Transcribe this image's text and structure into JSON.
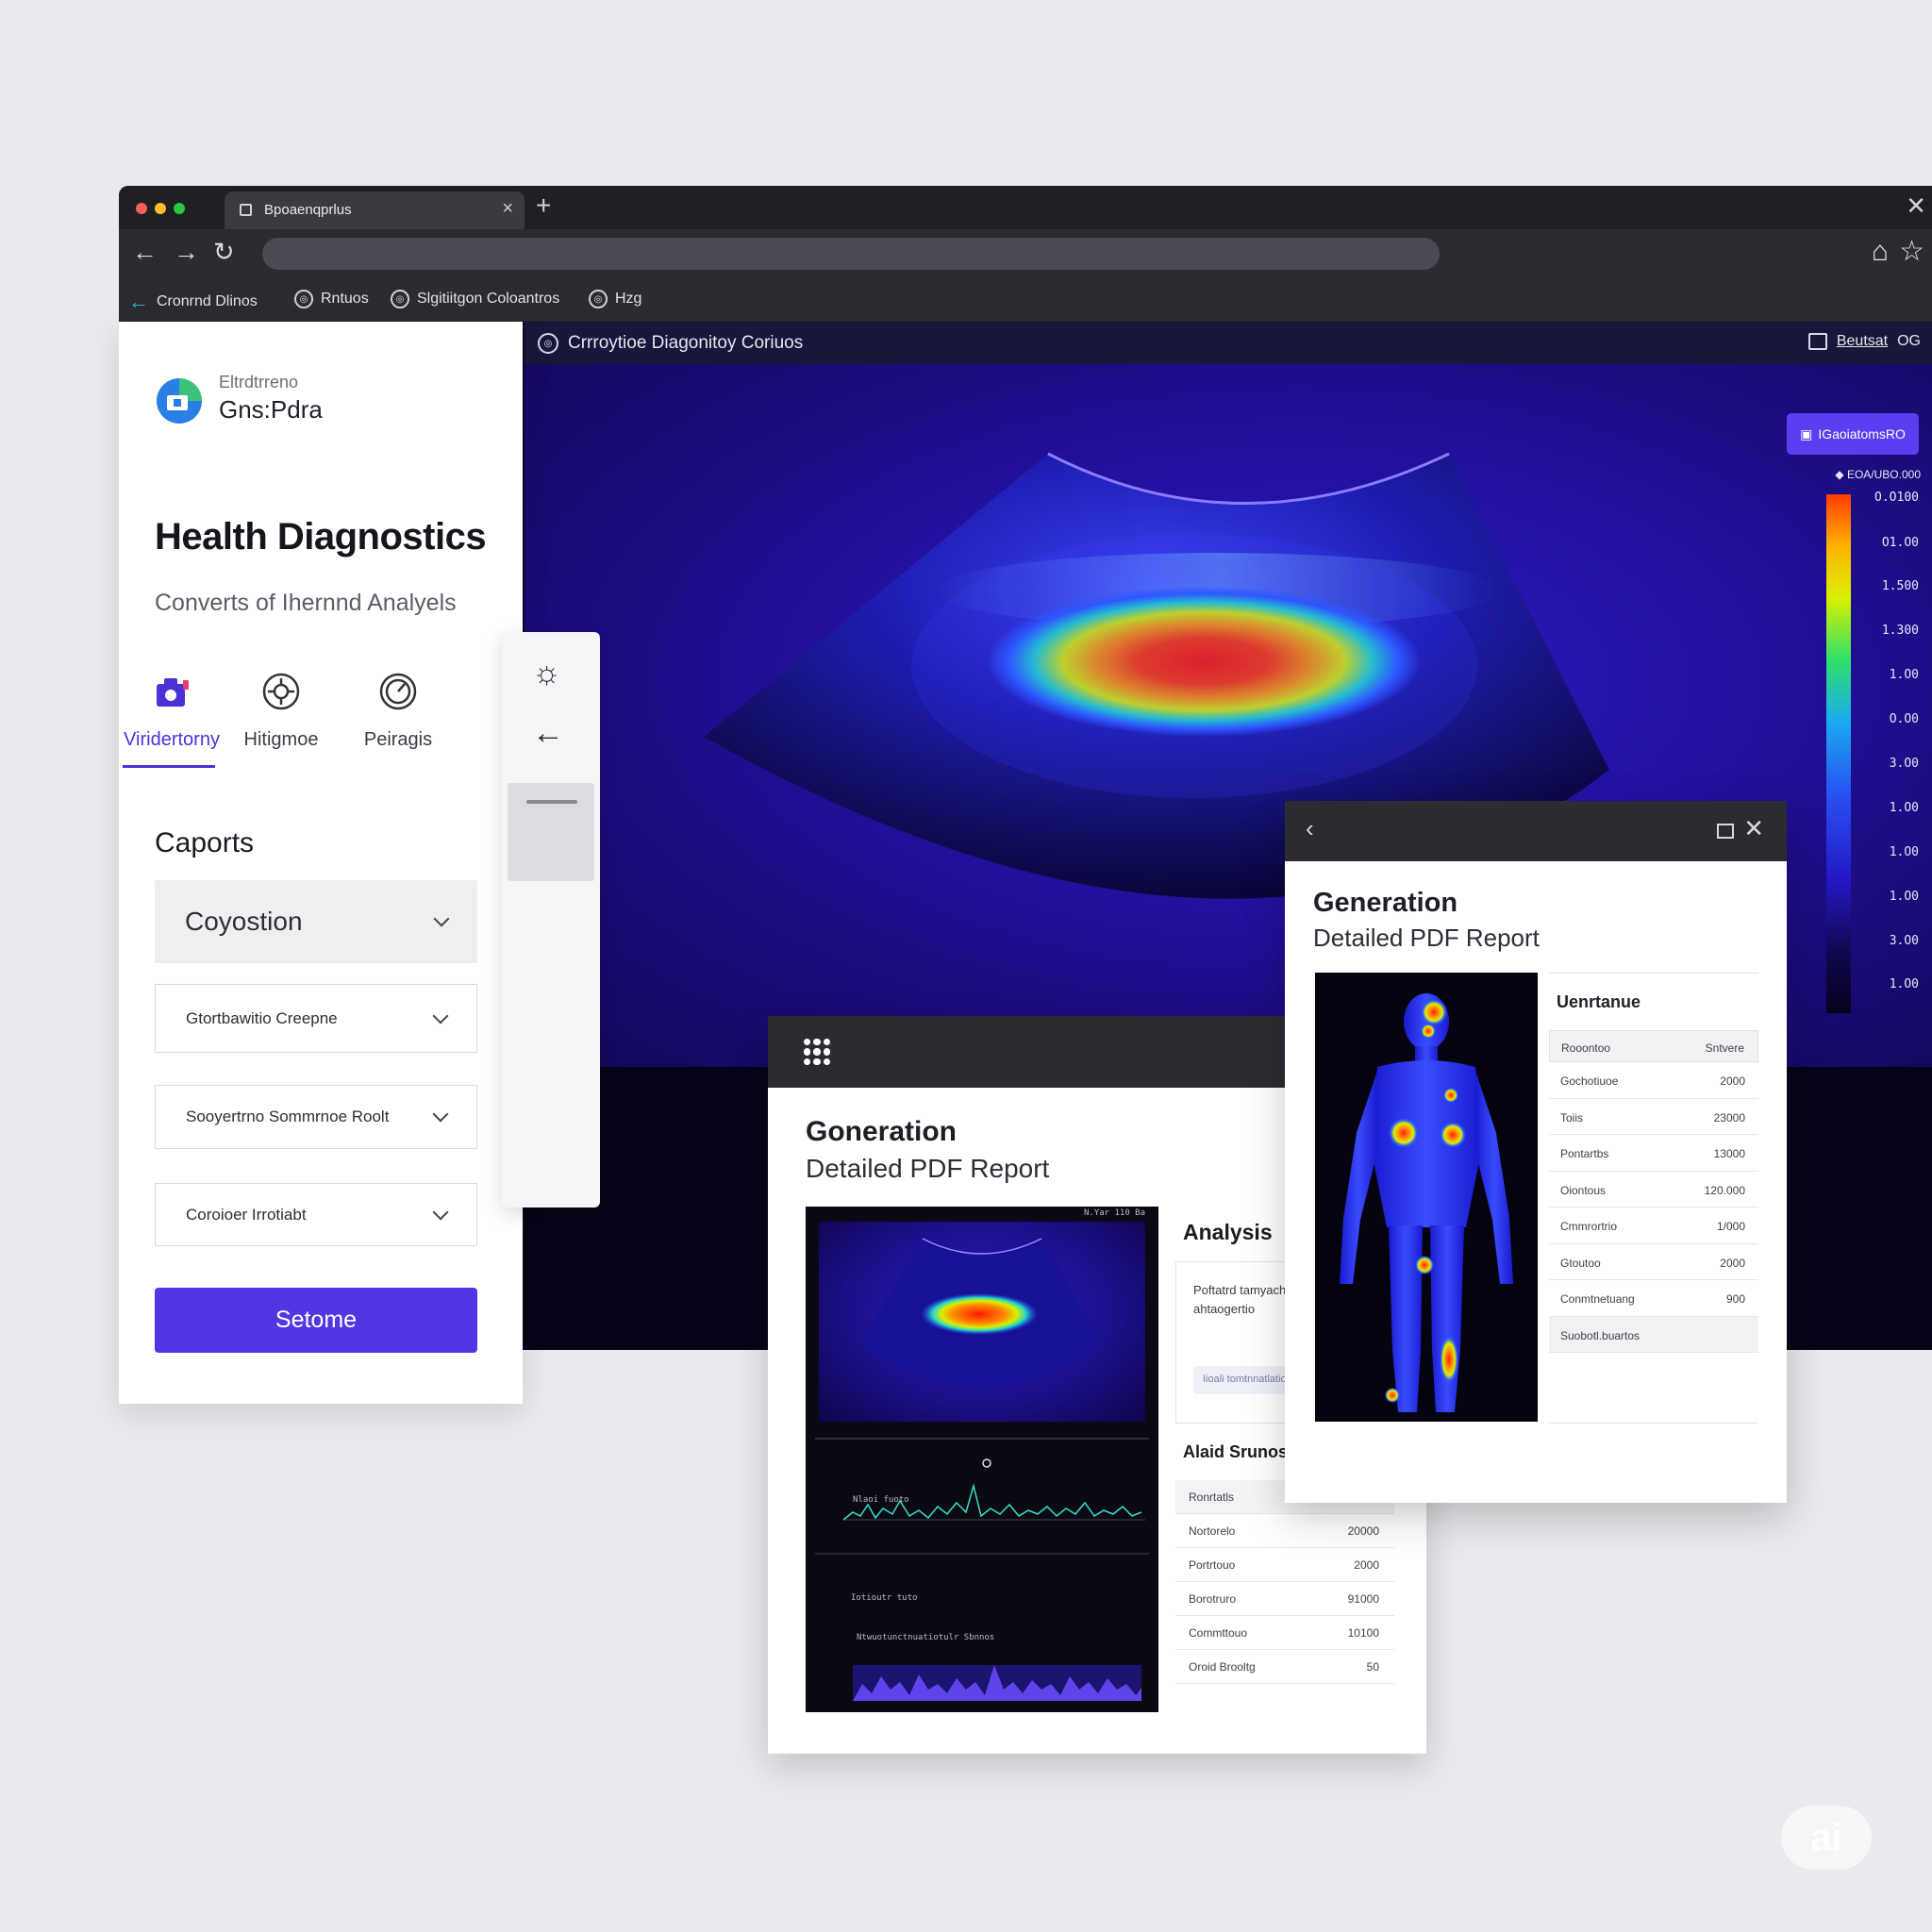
{
  "browser": {
    "tab_title": "Bpoaenqprlus",
    "bookmarks": [
      {
        "label": "Cronrnd Dlinos",
        "icon": "back-arrow-icon"
      },
      {
        "label": "Rntuos",
        "icon": "circle-icon"
      },
      {
        "label": "Slgitiitgon Coloantros",
        "icon": "circle-icon"
      },
      {
        "label": "Hzg",
        "icon": "circle-icon"
      }
    ]
  },
  "viewer": {
    "title": "Crrroytioe Diagonitoy Coriuos",
    "right_label": "Beutsat",
    "right_code": "OG",
    "legend_button": "IGaoiatomsRO",
    "legend_top_label": "EOA/UBO.000",
    "colorbar_ticks": [
      "O.O100",
      "O1.O0",
      "1.500",
      "1.300",
      "1.O0",
      "O.O0",
      "3.O0",
      "1.O0",
      "1.O0",
      "1.O0",
      "3.O0",
      "1.O0"
    ],
    "colors": {
      "accent": "#5235e3",
      "scan_bg": "#2210a0"
    }
  },
  "sidebar": {
    "brand_small": "Eltrdtrreno",
    "brand_big": "Gns:Pdra",
    "title": "Health Diagnostics",
    "subtitle": "Converts of Ihernnd Analyels",
    "tabs": [
      {
        "label": "Viridertorny",
        "icon": "camera-icon",
        "active": true
      },
      {
        "label": "Hitigmoe",
        "icon": "target-icon",
        "active": false
      },
      {
        "label": "Peiragis",
        "icon": "gauge-icon",
        "active": false
      }
    ],
    "export_label": "Caports",
    "selects": [
      {
        "value": "Coyostion"
      },
      {
        "value": "Gtortbawitio Creepne"
      },
      {
        "value": "Sooyertrno Sommrnoe Roolt"
      },
      {
        "value": "Coroioer Irrotiabt"
      }
    ],
    "primary_button": "Setome"
  },
  "report": {
    "title": "Goneration",
    "subtitle": "Detailed PDF Report",
    "analysis_title": "Analysis",
    "analysis_text": "Poftatrd tamyach corrie ofttrepnve ahtaogertio",
    "analysis_chip": "Iioali tomtnnatlatio",
    "status_title": "Alaid Srunos",
    "status_rows": [
      {
        "k": "Ronrtatls",
        "v": ""
      },
      {
        "k": "Nortorelo",
        "v": "20000"
      },
      {
        "k": "Portrtouo",
        "v": "2000"
      },
      {
        "k": "Borotruro",
        "v": "91000"
      },
      {
        "k": "Commttouo",
        "v": "10100"
      },
      {
        "k": "Oroid Brooltg",
        "v": "50"
      }
    ],
    "img_labels": {
      "top_right": "N.Yar 110 Ba",
      "series_1": "Nlaoi fuoto",
      "caption_mid": "Iotioutr tuto",
      "series_2": "Ntwuotunctnuatiotulr Sbnnos"
    }
  },
  "popup": {
    "title": "Generation",
    "subtitle": "Detailed PDF Report",
    "table_title": "Uenrtanue",
    "table_head": {
      "k": "Rooontoo",
      "v": "Sntvere"
    },
    "rows": [
      {
        "k": "Gochotiuoe",
        "v": "2000"
      },
      {
        "k": "Toiis",
        "v": "23000"
      },
      {
        "k": "Pontartbs",
        "v": "13000"
      },
      {
        "k": "Oiontous",
        "v": "120.000"
      },
      {
        "k": "Cmmrortrio",
        "v": "1/000"
      },
      {
        "k": "Gtoutoo",
        "v": "2000"
      },
      {
        "k": "Conmtnetuang",
        "v": "900"
      }
    ],
    "table_foot": "Suobotl.buartos"
  },
  "watermark": "ai"
}
